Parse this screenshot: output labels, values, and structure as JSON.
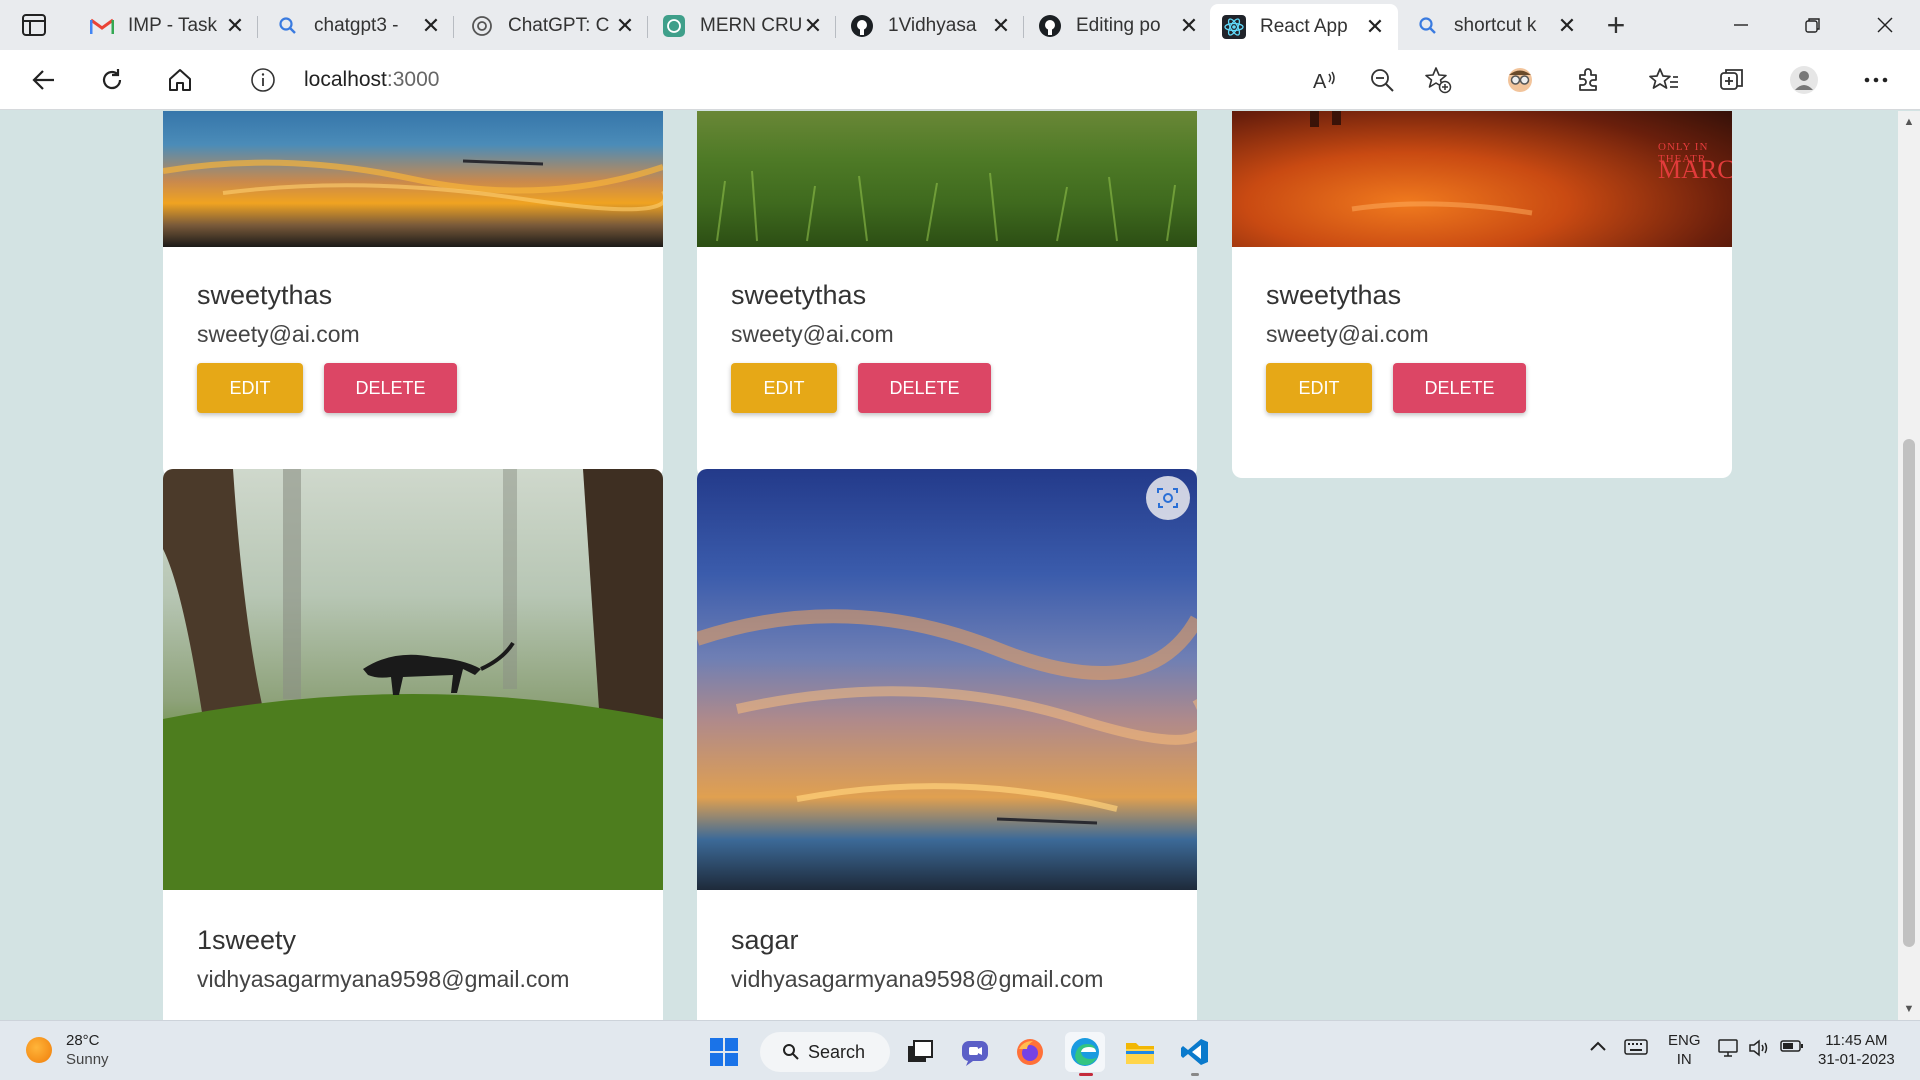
{
  "browser": {
    "tabs": [
      {
        "title": "IMP - Task",
        "icon": "gmail-icon"
      },
      {
        "title": "chatgpt3 -",
        "icon": "search-icon"
      },
      {
        "title": "ChatGPT: C",
        "icon": "openai-icon"
      },
      {
        "title": "MERN CRU",
        "icon": "openai-icon"
      },
      {
        "title": "1Vidhyasa",
        "icon": "github-icon"
      },
      {
        "title": "Editing po",
        "icon": "github-icon"
      },
      {
        "title": "React App",
        "icon": "react-icon",
        "active": true
      },
      {
        "title": "shortcut k",
        "icon": "search-icon"
      }
    ],
    "url_host": "localhost",
    "url_port": ":3000"
  },
  "cards": [
    {
      "name": "sweetythas",
      "email": "sweety@ai.com",
      "image": "sunset-sky",
      "edit_label": "EDIT",
      "delete_label": "DELETE"
    },
    {
      "name": "sweetythas",
      "email": "sweety@ai.com",
      "image": "grass-field",
      "edit_label": "EDIT",
      "delete_label": "DELETE"
    },
    {
      "name": "sweetythas",
      "email": "sweety@ai.com",
      "image": "movie-poster",
      "edit_label": "EDIT",
      "delete_label": "DELETE",
      "poster_text": [
        "ONLY IN THEATR",
        "MARCH"
      ]
    },
    {
      "name": "1sweety",
      "email": "vidhyasagarmyana9598@gmail.com",
      "image": "panther-forest"
    },
    {
      "name": "sagar",
      "email": "vidhyasagarmyana9598@gmail.com",
      "image": "sunset-clouds"
    }
  ],
  "taskbar": {
    "weather_temp": "28°C",
    "weather_cond": "Sunny",
    "search_label": "Search",
    "lang_top": "ENG",
    "lang_bottom": "IN",
    "time": "11:45 AM",
    "date": "31-01-2023"
  },
  "colors": {
    "page_bg": "#d3e3e3",
    "edit_button": "#e6a817",
    "delete_button": "#dc4665"
  }
}
